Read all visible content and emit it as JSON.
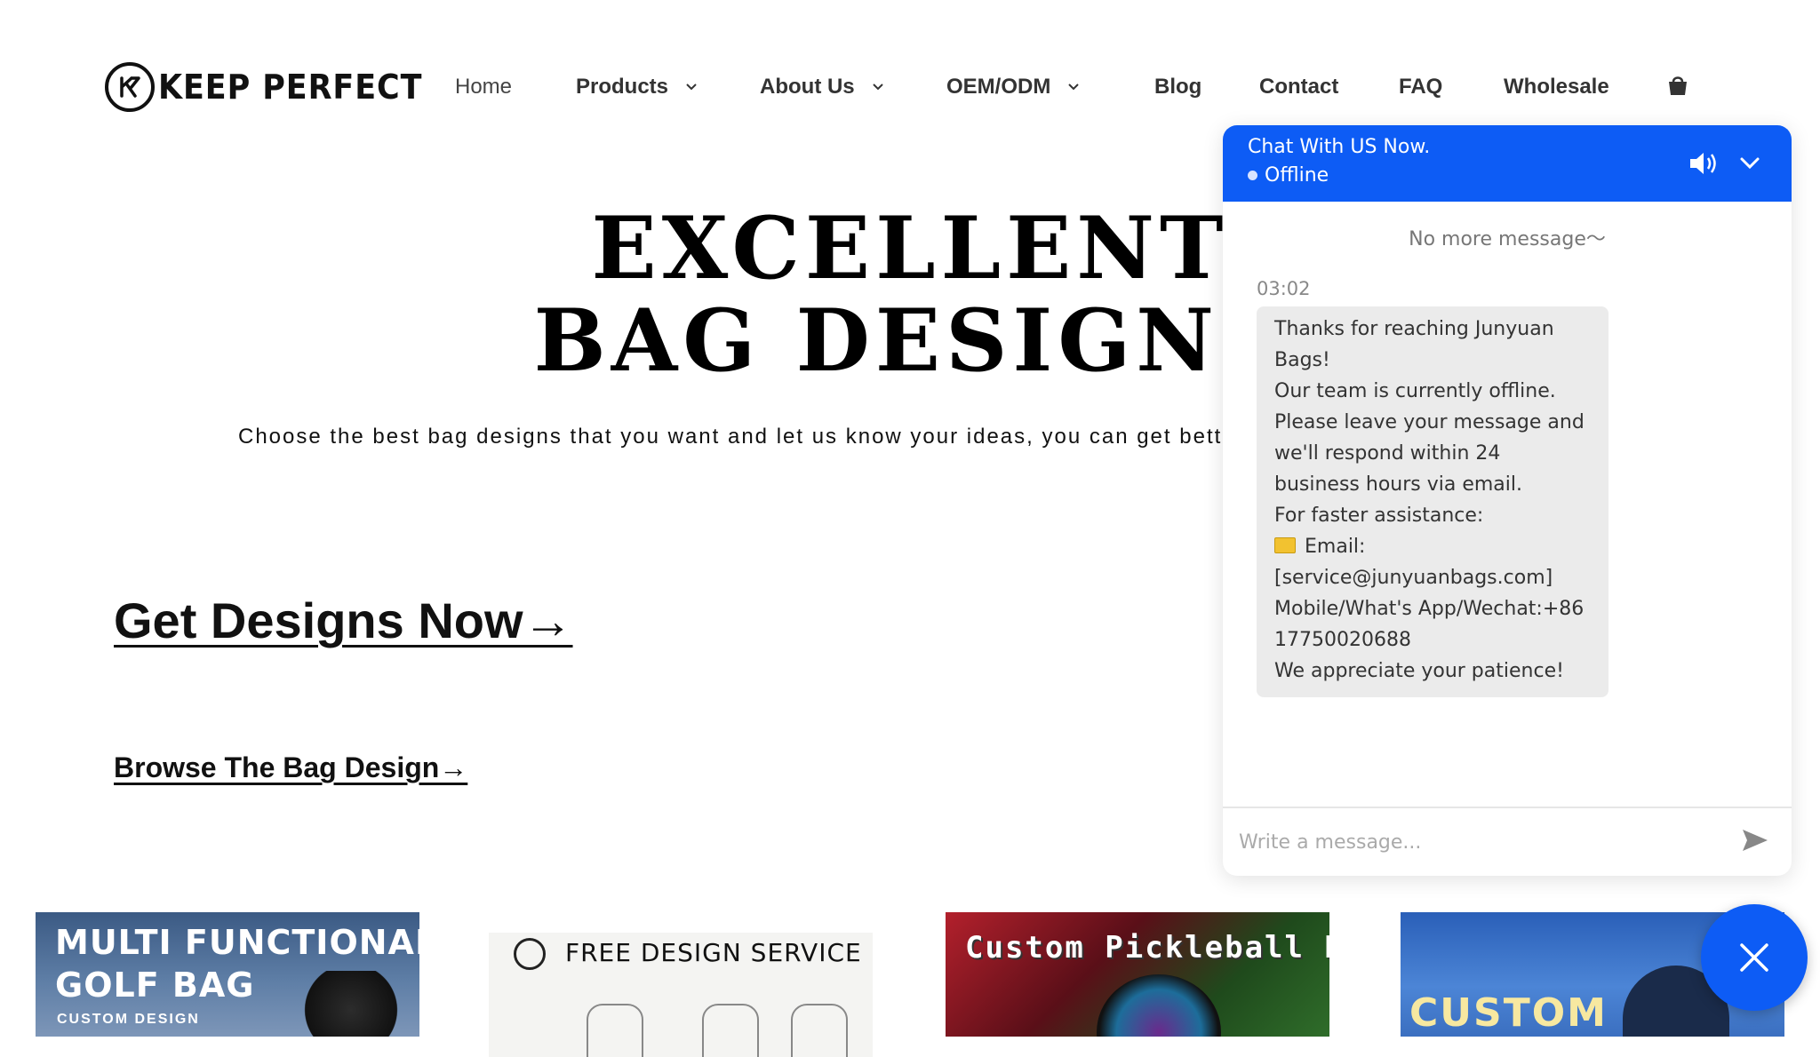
{
  "header": {
    "logo_text": "KEEP PERFECT",
    "nav": [
      {
        "label": "Home",
        "has_dropdown": false
      },
      {
        "label": "Products",
        "has_dropdown": true
      },
      {
        "label": "About Us",
        "has_dropdown": true
      },
      {
        "label": "OEM/ODM",
        "has_dropdown": true
      },
      {
        "label": "Blog",
        "has_dropdown": false
      },
      {
        "label": "Contact",
        "has_dropdown": false
      },
      {
        "label": "FAQ",
        "has_dropdown": false
      },
      {
        "label": "Wholesale",
        "has_dropdown": false
      }
    ],
    "cart_icon": "shopping-bag-icon"
  },
  "hero": {
    "title_line1": "EXCELLENT",
    "title_line2": "BAG DESIGNS",
    "subtitle": "Choose the best bag designs that you want and let us know your ideas, you can get bette",
    "cta_primary": "Get Designs Now→",
    "cta_secondary": "Browse The Bag Design→"
  },
  "cards": [
    {
      "line1": "MULTI FUNCTIONAL",
      "line2": "GOLF BAG",
      "line3": "CUSTOM DESIGN"
    },
    {
      "title": "FREE DESIGN SERVICE"
    },
    {
      "title": "Custom Pickleball Bag"
    },
    {
      "title": "CUSTOM"
    }
  ],
  "chat": {
    "title": "Chat With US Now.",
    "status": "Offline",
    "no_more": "No more message～",
    "time": "03:02",
    "message_lines": [
      "Thanks for reaching Junyuan",
      "Bags!",
      "Our team is currently offline.",
      "Please leave your message and",
      "we'll respond within 24",
      "business hours via email.",
      "For faster assistance:",
      "Email:",
      "[service@junyuanbags.com]",
      "Mobile/What's App/Wechat:+86",
      "17750020688",
      "We appreciate your patience!"
    ],
    "input_placeholder": "Write a message...",
    "colors": {
      "accent": "#0d5cf5",
      "bubble": "#ebebeb"
    }
  }
}
